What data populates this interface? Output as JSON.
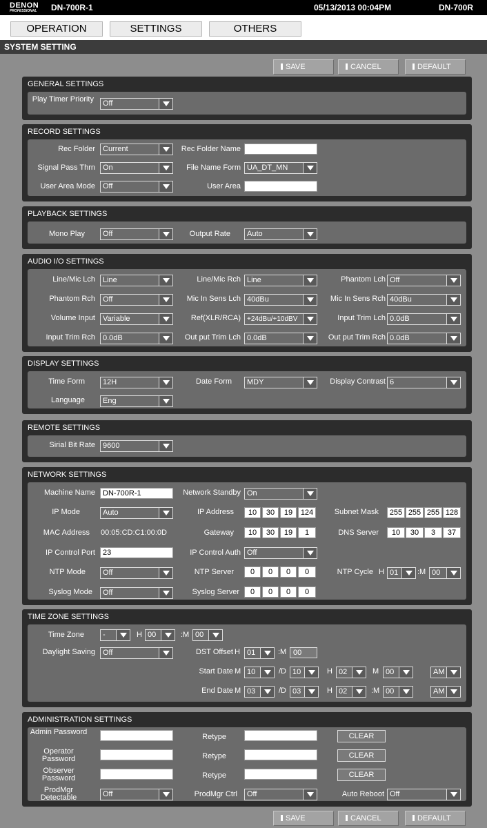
{
  "header": {
    "logo": "DENON",
    "logo_sub": "PROFESSIONAL",
    "model": "DN-700R-1",
    "datetime": "05/13/2013 00:04PM",
    "model_short": "DN-700R"
  },
  "tabs": [
    "OPERATION",
    "SETTINGS",
    "OTHERS"
  ],
  "system_title": "SYSTEM SETTING",
  "buttons": {
    "save": "SAVE",
    "cancel": "CANCEL",
    "default": "DEFAULT"
  },
  "general": {
    "title": "GENERAL SETTINGS",
    "play_timer_label": "Play Timer Priority",
    "play_timer": "Off"
  },
  "record": {
    "title": "RECORD SETTINGS",
    "rec_folder_label": "Rec Folder",
    "rec_folder": "Current",
    "rec_folder_name_label": "Rec Folder Name",
    "rec_folder_name": "",
    "signal_pass_label": "Signal Pass Thrn",
    "signal_pass": "On",
    "file_name_form_label": "File Name Form",
    "file_name_form": "UA_DT_MN",
    "user_area_mode_label": "User Area Mode",
    "user_area_mode": "Off",
    "user_area_label": "User Area",
    "user_area": ""
  },
  "playback": {
    "title": "PLAYBACK SETTINGS",
    "mono_play_label": "Mono Play",
    "mono_play": "Off",
    "output_rate_label": "Output Rate",
    "output_rate": "Auto"
  },
  "audio": {
    "title": "AUDIO I/O SETTINGS",
    "line_mic_lch_label": "Line/Mic Lch",
    "line_mic_lch": "Line",
    "line_mic_rch_label": "Line/Mic Rch",
    "line_mic_rch": "Line",
    "phantom_lch_label": "Phantom Lch",
    "phantom_lch": "Off",
    "phantom_rch_label": "Phantom Rch",
    "phantom_rch": "Off",
    "mic_in_lch_label": "Mic In Sens Lch",
    "mic_in_lch": "40dBu",
    "mic_in_rch_label": "Mic In Sens Rch",
    "mic_in_rch": "40dBu",
    "volume_input_label": "Volume Input",
    "volume_input": "Variable",
    "ref_label": "Ref(XLR/RCA)",
    "ref": "+24dBu/+10dBV",
    "input_trim_lch_label": "Input Trim Lch",
    "input_trim_lch": "0.0dB",
    "input_trim_rch_label": "Input Trim Rch",
    "input_trim_rch": "0.0dB",
    "output_trim_lch_label": "Out put Trim Lch",
    "output_trim_lch": "0.0dB",
    "output_trim_rch_label": "Out put Trim Rch",
    "output_trim_rch": "0.0dB"
  },
  "display": {
    "title": "DISPLAY SETTINGS",
    "time_form_label": "Time Form",
    "time_form": "12H",
    "date_form_label": "Date Form",
    "date_form": "MDY",
    "contrast_label": "Display Contrast",
    "contrast": "6",
    "language_label": "Language",
    "language": "Eng"
  },
  "remote": {
    "title": "REMOTE SETTINGS",
    "bit_rate_label": "Sirial Bit Rate",
    "bit_rate": "9600"
  },
  "network": {
    "title": "NETWORK SETTINGS",
    "machine_name_label": "Machine Name",
    "machine_name": "DN-700R-1",
    "standby_label": "Network Standby",
    "standby": "On",
    "ip_mode_label": "IP Mode",
    "ip_mode": "Auto",
    "ip_address_label": "IP Address",
    "ip_address": [
      "10",
      "30",
      "19",
      "124"
    ],
    "subnet_label": "Subnet Mask",
    "subnet": [
      "255",
      "255",
      "255",
      "128"
    ],
    "mac_label": "MAC Address",
    "mac": "00:05:CD:C1:00:0D",
    "gateway_label": "Gateway",
    "gateway": [
      "10",
      "30",
      "19",
      "1"
    ],
    "dns_label": "DNS Server",
    "dns": [
      "10",
      "30",
      "3",
      "37"
    ],
    "ipc_port_label": "IP Control Port",
    "ipc_port": "23",
    "ipc_auth_label": "IP Control Auth",
    "ipc_auth": "Off",
    "ntp_mode_label": "NTP Mode",
    "ntp_mode": "Off",
    "ntp_server_label": "NTP Server",
    "ntp_server": [
      "0",
      "0",
      "0",
      "0"
    ],
    "ntp_cycle_label": "NTP Cycle",
    "ntp_cycle_h_prefix": "H",
    "ntp_cycle_h": "01",
    "ntp_cycle_m_prefix": ":M",
    "ntp_cycle_m": "00",
    "syslog_mode_label": "Syslog Mode",
    "syslog_mode": "Off",
    "syslog_server_label": "Syslog Server",
    "syslog_server": [
      "0",
      "0",
      "0",
      "0"
    ]
  },
  "timezone": {
    "title": "TIME ZONE SETTINGS",
    "tz_label": "Time Zone",
    "tz_sign": "-",
    "h_prefix": "H",
    "tz_h": "00",
    "m_prefix": ":M",
    "tz_m": "00",
    "dst_label": "Daylight Saving",
    "dst": "Off",
    "dst_offset_label": "DST Offset",
    "dst_offset_h": "01",
    "dst_offset_m": "00",
    "start_label": "Start Date",
    "m_prefix_date": "M",
    "d_prefix": "/D",
    "min_prefix": "M",
    "start_month": "10",
    "start_day": "10",
    "start_h": "02",
    "start_min": "00",
    "start_ampm": "AM",
    "end_label": "End Date",
    "end_month": "03",
    "end_day": "03",
    "end_h": "02",
    "end_min_prefix": ":M",
    "end_min": "00",
    "end_ampm": "AM"
  },
  "admin": {
    "title": "ADMINISTRATION SETTINGS",
    "admin_pw_label": "Admin Password",
    "operator_pw_label": "Operator Password",
    "observer_pw_label": "Observer Password",
    "retype_label": "Retype",
    "clear_label": "CLEAR",
    "prodmgr_det_label": "ProdMgr Detectable",
    "prodmgr_det": "Off",
    "prodmgr_ctrl_label": "ProdMgr Ctrl",
    "prodmgr_ctrl": "Off",
    "auto_reboot_label": "Auto Reboot",
    "auto_reboot": "Off"
  }
}
